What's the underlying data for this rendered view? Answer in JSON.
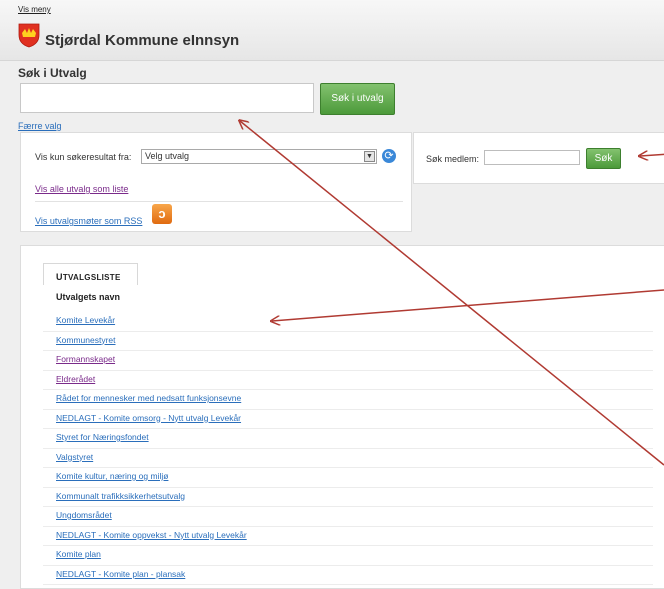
{
  "header": {
    "menu_link": "Vis meny",
    "title": "Stjørdal Kommune eInnsyn"
  },
  "search": {
    "title": "Søk i Utvalg",
    "input_value": "",
    "button_label": "Søk i utvalg",
    "fewer_options": "Færre valg"
  },
  "filter": {
    "label": "Vis kun søkeresultat fra:",
    "selected": "Velg utvalg",
    "show_all_link": "Vis alle utvalg som liste",
    "rss_link": "Vis utvalgsmøter som RSS"
  },
  "member_search": {
    "label": "Søk medlem:",
    "input_value": "",
    "button_label": "Søk"
  },
  "list": {
    "tab": "Utvalgsliste",
    "column_header": "Utvalgets navn",
    "items": [
      {
        "name": "Komite Levekår",
        "visited": false
      },
      {
        "name": "Kommunestyret",
        "visited": false
      },
      {
        "name": "Formannskapet",
        "visited": true
      },
      {
        "name": "Eldrerådet",
        "visited": true
      },
      {
        "name": "Rådet for mennesker med nedsatt funksjonsevne",
        "visited": false
      },
      {
        "name": "NEDLAGT - Komite omsorg - Nytt utvalg Levekår",
        "visited": false
      },
      {
        "name": "Styret for Næringsfondet",
        "visited": false
      },
      {
        "name": "Valgstyret",
        "visited": false
      },
      {
        "name": "Komite kultur, næring og miljø",
        "visited": false
      },
      {
        "name": "Kommunalt trafikksikkerhetsutvalg",
        "visited": false
      },
      {
        "name": "Ungdomsrådet",
        "visited": false
      },
      {
        "name": "NEDLAGT - Komite oppvekst - Nytt utvalg Levekår",
        "visited": false
      },
      {
        "name": "Komite plan",
        "visited": false
      },
      {
        "name": "NEDLAGT - Komite plan - plansak",
        "visited": false
      }
    ]
  },
  "colors": {
    "link": "#2a6ebb",
    "visited_link": "#7a2a8a",
    "button_green": "#5ea84a",
    "arrow": "#b03a32",
    "logo_red": "#e03020"
  },
  "icons": {
    "logo": "coat-of-arms-icon",
    "refresh": "refresh-icon",
    "rss": "rss-icon",
    "dropdown": "chevron-down-icon"
  }
}
